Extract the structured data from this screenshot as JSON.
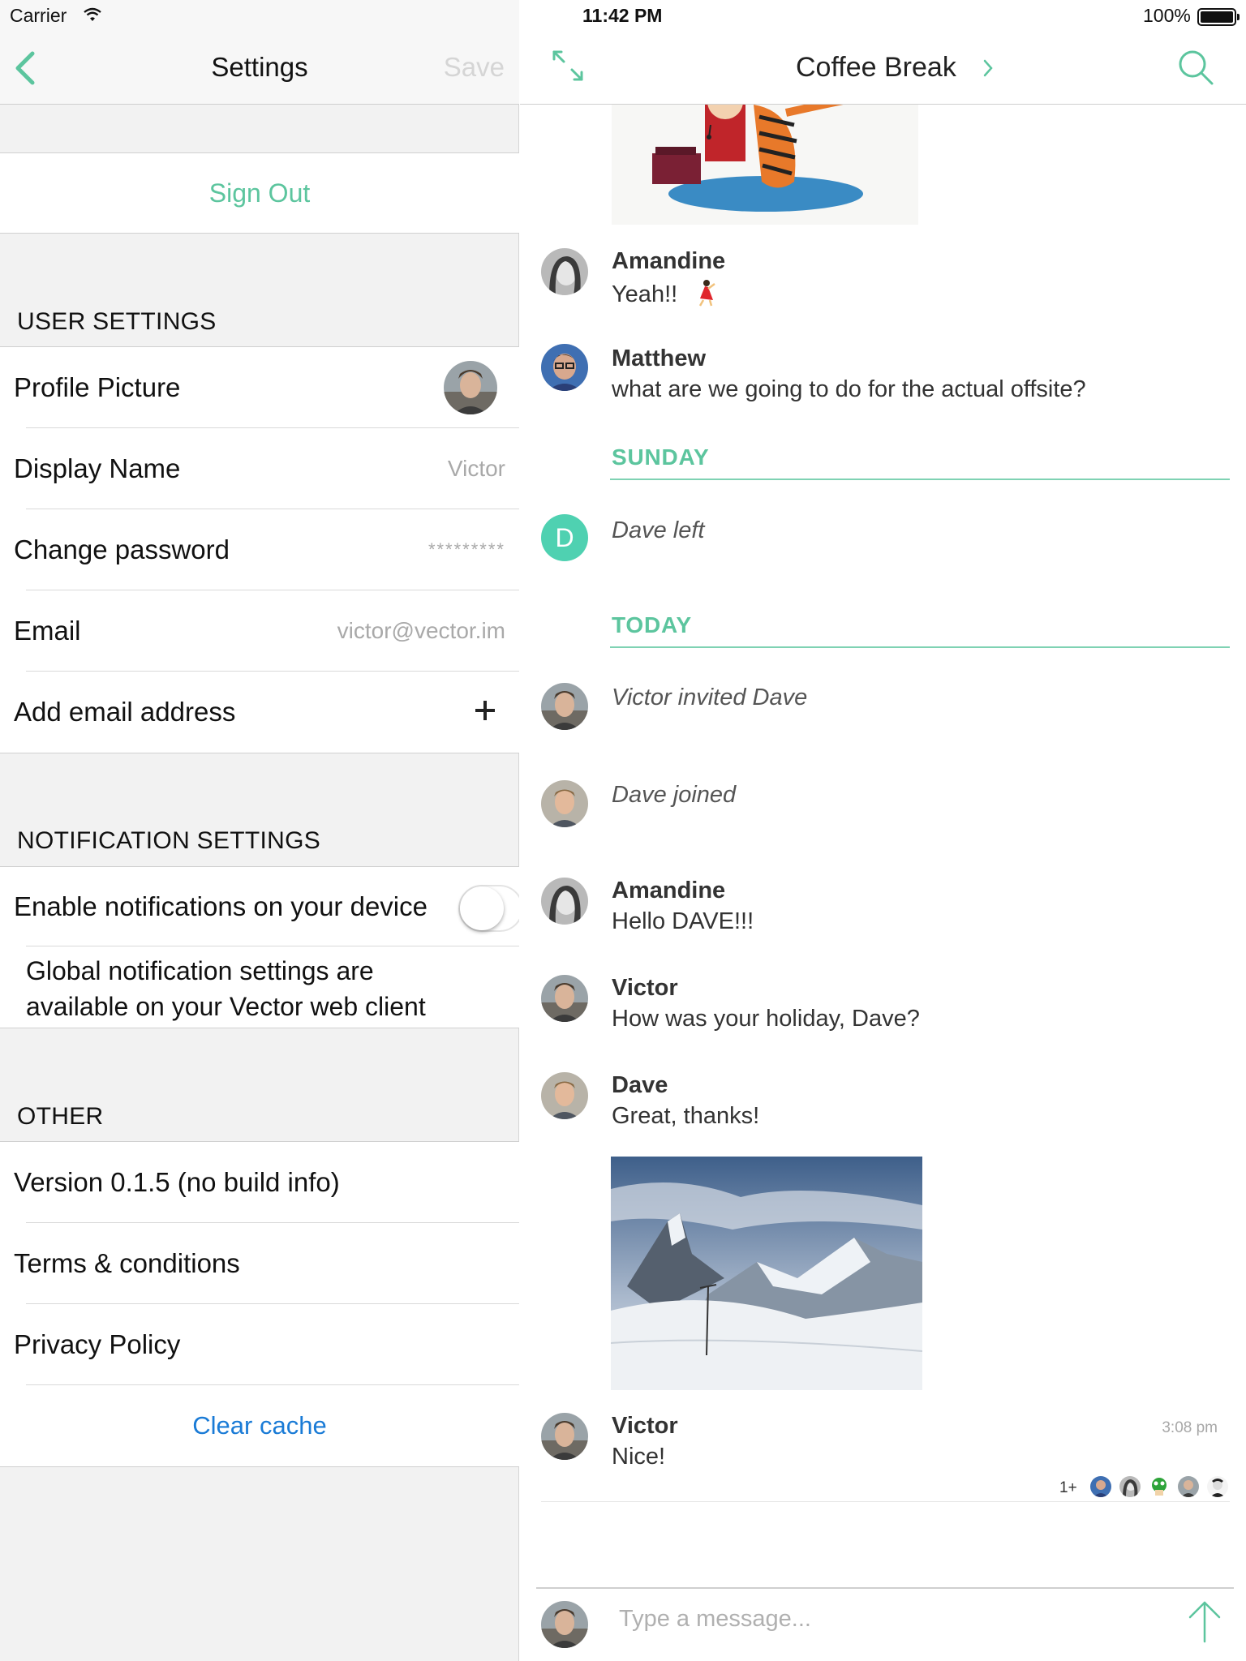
{
  "status_bar": {
    "carrier": "Carrier",
    "time": "11:42 PM",
    "battery": "100%"
  },
  "settings": {
    "title": "Settings",
    "save_label": "Save",
    "sign_out": "Sign Out",
    "user_settings_header": "USER SETTINGS",
    "user_rows": {
      "profile_picture": "Profile Picture",
      "display_name": "Display Name",
      "display_name_value": "Victor",
      "change_password": "Change password",
      "password_value": "*********",
      "email": "Email",
      "email_value": "victor@vector.im",
      "add_email": "Add email address"
    },
    "notification_header": "NOTIFICATION SETTINGS",
    "enable_notifications": "Enable notifications on your device",
    "enable_notifications_on": false,
    "global_note_line1": "Global notification settings are",
    "global_note_line2": "available on your Vector web client",
    "other_header": "OTHER",
    "other_rows": {
      "version": "Version 0.1.5 (no build info)",
      "terms": "Terms & conditions",
      "privacy": "Privacy Policy",
      "clear_cache": "Clear cache"
    }
  },
  "chat": {
    "room_name": "Coffee Break",
    "messages": [
      {
        "sender": "Amandine",
        "text": "Yeah!!"
      },
      {
        "sender": "Matthew",
        "text": "what are we going to do for the actual offsite?"
      }
    ],
    "day_sunday": "SUNDAY",
    "dave_avatar_letter": "D",
    "event_dave_left": "Dave left",
    "day_today": "TODAY",
    "event_invited": "Victor invited Dave",
    "event_joined": "Dave joined",
    "today_messages": [
      {
        "sender": "Amandine",
        "text": "Hello DAVE!!!"
      },
      {
        "sender": "Victor",
        "text": "How was your holiday, Dave?"
      },
      {
        "sender": "Dave",
        "text": "Great, thanks!"
      },
      {
        "sender": "Victor",
        "text": "Nice!",
        "time": "3:08 pm"
      }
    ],
    "read_receipts_more": "1+",
    "composer_placeholder": "Type a message..."
  },
  "colors": {
    "accent": "#5cc59e",
    "link_blue": "#1a7bd6"
  }
}
